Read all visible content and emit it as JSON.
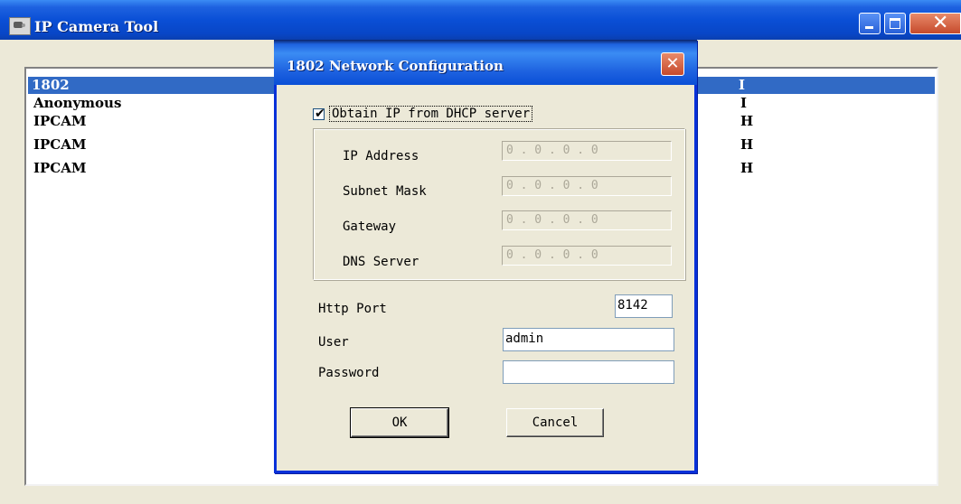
{
  "main_window": {
    "title": "IP Camera Tool",
    "devices": [
      {
        "name": "1802",
        "status": "I",
        "selected": true
      },
      {
        "name": "Anonymous",
        "status": "I",
        "selected": false
      },
      {
        "name": "IPCAM",
        "status": "H",
        "selected": false
      },
      {
        "name": "IPCAM",
        "status": "H",
        "selected": false
      },
      {
        "name": "IPCAM",
        "status": "H",
        "selected": false
      }
    ]
  },
  "dialog": {
    "title": "1802 Network Configuration",
    "close_glyph": "✕",
    "dhcp": {
      "label": "Obtain IP from DHCP server",
      "checked": true,
      "check_glyph": "✔"
    },
    "ip_fields": [
      {
        "label": "IP Address",
        "value": "0 . 0 . 0 . 0"
      },
      {
        "label": "Subnet Mask",
        "value": "0 . 0 . 0 . 0"
      },
      {
        "label": "Gateway",
        "value": "0 . 0 . 0 . 0"
      },
      {
        "label": "DNS Server",
        "value": "0 . 0 . 0 . 0"
      }
    ],
    "http_port": {
      "label": "Http Port",
      "value": "8142"
    },
    "user": {
      "label": "User",
      "value": "admin"
    },
    "password": {
      "label": "Password",
      "value": ""
    },
    "ok_label": "OK",
    "cancel_label": "Cancel"
  }
}
